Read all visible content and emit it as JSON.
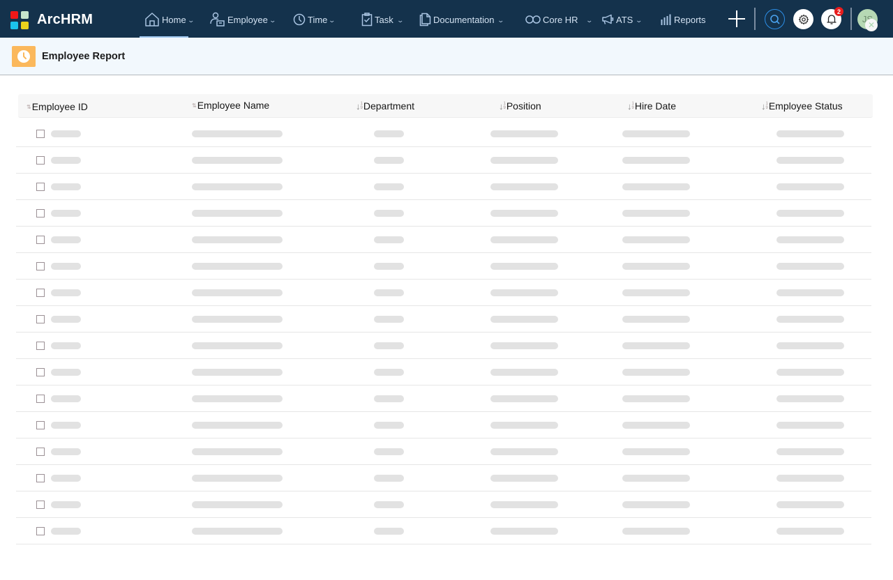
{
  "app": {
    "brand": "ArcHRM",
    "logo_colors": [
      "#f01818",
      "#c6e4cc",
      "#1bc3ec",
      "#ead11c"
    ],
    "nav_bg": "#14324c"
  },
  "nav": {
    "items": [
      {
        "label": "Home",
        "icon": "home-icon",
        "has_dropdown": true,
        "active": true
      },
      {
        "label": "Employee",
        "icon": "employee-icon",
        "has_dropdown": true
      },
      {
        "label": "Time",
        "icon": "clock-icon",
        "has_dropdown": true
      },
      {
        "label": "Task",
        "icon": "clipboard-check-icon",
        "has_dropdown": true
      },
      {
        "label": "Documentation",
        "icon": "documents-icon",
        "has_dropdown": true
      },
      {
        "label": "Core HR",
        "icon": "infinity-icon",
        "has_dropdown": true
      },
      {
        "label": "ATS",
        "icon": "megaphone-icon",
        "has_dropdown": true
      },
      {
        "label": "Reports",
        "icon": "bar-chart-icon",
        "has_dropdown": false
      }
    ],
    "chevron": "⌄",
    "actions": {
      "add": "plus-icon",
      "search": "search-icon",
      "settings": "gear-icon",
      "notifications": "bell-icon",
      "notification_count": "2",
      "avatar_initials": "JS",
      "avatar_overlay": "✕"
    }
  },
  "page": {
    "title": "Employee Report",
    "icon": "clock-icon",
    "icon_color": "#fbb85c"
  },
  "table": {
    "columns": [
      {
        "label": "Employee ID",
        "sort_icon": "sort-alpha-icon"
      },
      {
        "label": "Employee Name",
        "sort_icon": "sort-alpha-icon"
      },
      {
        "label": "Department",
        "sort_icon": "sort-numeric-icon"
      },
      {
        "label": "Position",
        "sort_icon": "sort-numeric-icon"
      },
      {
        "label": "Hire Date",
        "sort_icon": "sort-numeric-icon"
      },
      {
        "label": "Employee Status",
        "sort_icon": "sort-numeric-icon"
      }
    ],
    "row_count": 16,
    "rows_state": "loading-skeleton",
    "sort_glyphs": {
      "alpha": "⇅",
      "arrow": "↓",
      "digit_top": "1",
      "digit_bottom": "9"
    }
  }
}
